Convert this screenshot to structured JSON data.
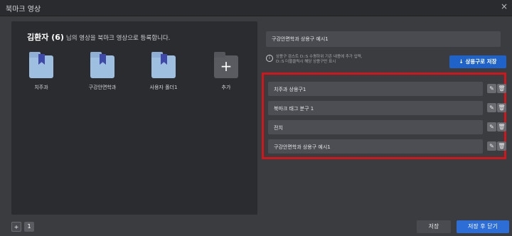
{
  "window": {
    "title": "북마크 영상",
    "close_label": "×"
  },
  "left_panel": {
    "user_name": "김환자 (6)",
    "description": "님의 영상을 북마크 영상으로 등록합니다.",
    "folders": [
      {
        "label": "치주과",
        "icon": "folder-bookmark-icon"
      },
      {
        "label": "구강안면학과",
        "icon": "folder-bookmark-icon"
      },
      {
        "label": "사용자 폴더1",
        "icon": "folder-bookmark-icon"
      }
    ],
    "add_folder": {
      "label": "추가",
      "symbol": "+"
    }
  },
  "right_panel": {
    "phrase_input_value": "구강안면학과 상용구 예시1",
    "info_text": "상용구 검스트 D::S 수평하위 기존 내용에 추가 입력,\nD::S 더블클릭시 해당 상용구만 표시",
    "save_phrase_label": "↓ 상용구로 저장",
    "phrases": [
      {
        "label": "치주과 상용구1"
      },
      {
        "label": "북마크 태그 분구 1"
      },
      {
        "label": "전치"
      },
      {
        "label": "구강안면학과 상용구 예시1"
      }
    ],
    "edit_symbol": "✎",
    "delete_symbol": "🗑"
  },
  "footer": {
    "add_symbol": "+",
    "page_number": "1",
    "save_label": "저장",
    "save_close_label": "저장 후 닫기"
  },
  "colors": {
    "accent": "#1f63c9",
    "highlight_border": "#d2141b",
    "folder": "#9fbfe0",
    "bookmark": "#3f4aa8"
  }
}
